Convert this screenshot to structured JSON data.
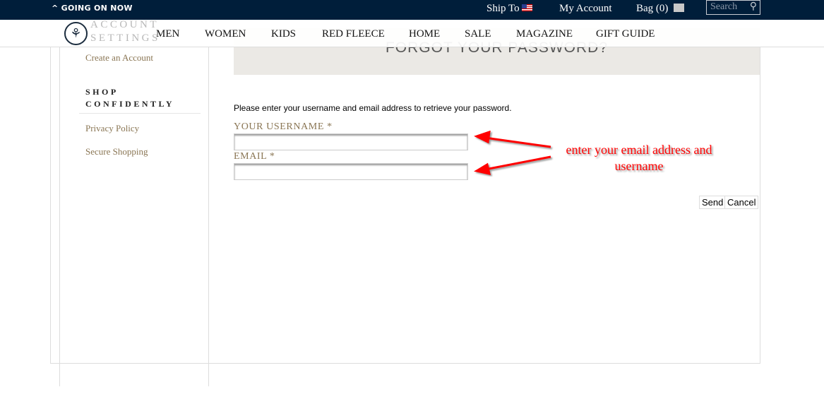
{
  "topbar": {
    "promo": "GOING ON NOW",
    "ship_to": "Ship To",
    "my_account": "My Account",
    "bag": "Bag (0)",
    "search_placeholder": "Search",
    "bg": "#001e3a"
  },
  "nav": {
    "items": [
      "MEN",
      "WOMEN",
      "KIDS",
      "RED FLEECE",
      "HOME",
      "SALE",
      "MAGAZINE",
      "GIFT GUIDE"
    ]
  },
  "sidebar": {
    "heading1": "ACCOUNT SETTINGS",
    "link_create": "Create an Account",
    "heading2_line1": "SHOP",
    "heading2_line2": "CONFIDENTLY",
    "links": [
      "Privacy Policy",
      "Secure Shopping"
    ]
  },
  "main": {
    "title": "FORGOT YOUR PASSWORD?",
    "instructions": "Please enter your username and email address to retrieve your password.",
    "username_label": "YOUR USERNAME *",
    "username_value": "",
    "email_label": "EMAIL *",
    "email_value": "",
    "send": "Send",
    "cancel": "Cancel"
  },
  "annotation": {
    "text_line1": "enter your email address and",
    "text_line2": "username",
    "color": "#ff0000"
  }
}
